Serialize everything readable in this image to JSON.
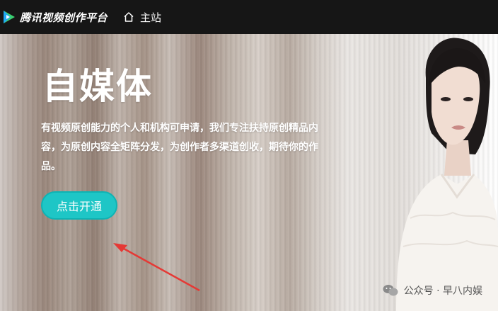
{
  "header": {
    "logo_text": "腾讯视频创作平台",
    "home_label": "主站"
  },
  "hero": {
    "title": "自媒体",
    "description": "有视频原创能力的个人和机构可申请，我们专注扶持原创精品内容，为原创内容全矩阵分发，为创作者多渠道创收，期待你的作品。",
    "cta_label": "点击开通"
  },
  "watermark": {
    "text": "公众号 · 早八内娱"
  },
  "colors": {
    "topbar": "#161616",
    "cta": "#1ec6c6",
    "annotation_arrow": "#e53935"
  },
  "icons": [
    "tencent-video-logo-icon",
    "home-icon",
    "wechat-icon"
  ]
}
